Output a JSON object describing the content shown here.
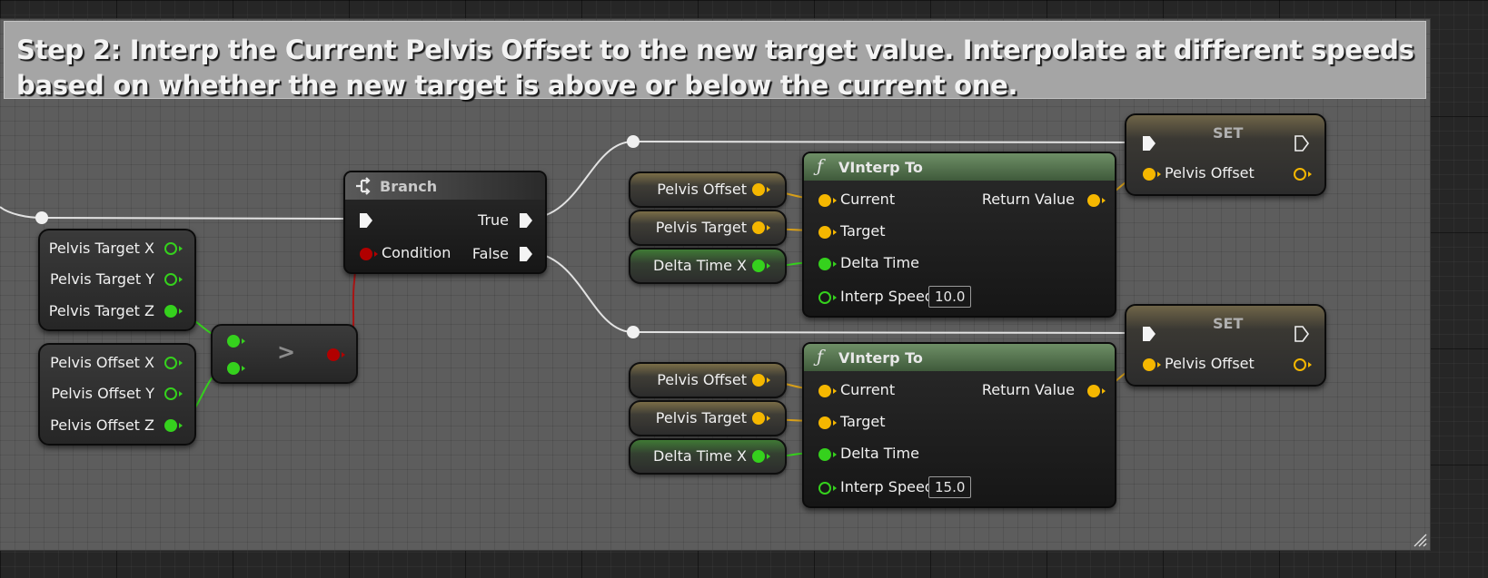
{
  "comment": {
    "text": "Step 2: Interp the Current Pelvis Offset to the new target value. Interpolate at different speeds based on whether the new target is above or below the current one."
  },
  "break_target": {
    "outputs": [
      "Pelvis Target X",
      "Pelvis Target Y",
      "Pelvis Target Z"
    ]
  },
  "break_offset": {
    "outputs": [
      "Pelvis Offset X",
      "Pelvis Offset Y",
      "Pelvis Offset Z"
    ]
  },
  "compare": {
    "operator": ">"
  },
  "branch": {
    "title": "Branch",
    "true_label": "True",
    "false_label": "False",
    "condition_label": "Condition"
  },
  "interp_top": {
    "title": "VInterp To",
    "current": "Current",
    "target": "Target",
    "delta": "Delta Time",
    "speed_label": "Interp Speed",
    "speed_value": "10.0",
    "return_label": "Return Value"
  },
  "interp_bottom": {
    "title": "VInterp To",
    "current": "Current",
    "target": "Target",
    "delta": "Delta Time",
    "speed_label": "Interp Speed",
    "speed_value": "15.0",
    "return_label": "Return Value"
  },
  "vars_top": {
    "pelvis_offset": "Pelvis Offset",
    "pelvis_target": "Pelvis Target",
    "delta_time_x": "Delta Time X"
  },
  "vars_bottom": {
    "pelvis_offset": "Pelvis Offset",
    "pelvis_target": "Pelvis Target",
    "delta_time_x": "Delta Time X"
  },
  "set_top": {
    "title": "SET",
    "pin_label": "Pelvis Offset"
  },
  "set_bottom": {
    "title": "SET",
    "pin_label": "Pelvis Offset"
  },
  "colors": {
    "exec": "#f4f4f4",
    "vector_pin": "#f5b700",
    "float_pin": "#35d11d",
    "bool_pin": "#b10000",
    "function_header": "#4f6e49"
  }
}
